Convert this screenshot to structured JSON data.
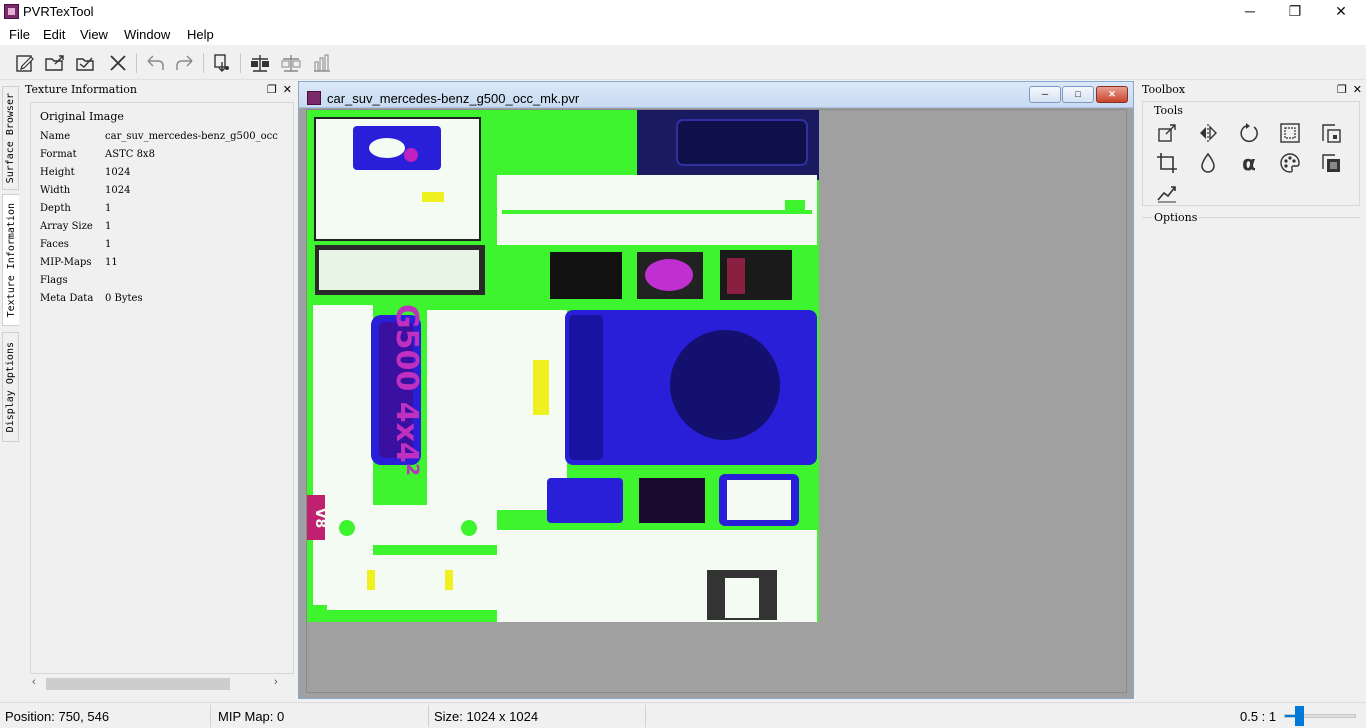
{
  "app": {
    "title": "PVRTexTool"
  },
  "window_controls": {
    "minimize": "─",
    "restore": "❐",
    "close": "✕"
  },
  "menu": [
    "File",
    "Edit",
    "View",
    "Window",
    "Help"
  ],
  "toolbar": {
    "items": [
      "new-icon",
      "open-icon",
      "open-folder-icon",
      "close-icon",
      "undo-icon",
      "redo-icon",
      "encode-icon",
      "compare-icon",
      "compare-alt-icon",
      "histogram-icon"
    ]
  },
  "left_tabs": [
    "Surface Browser",
    "Texture Information",
    "Display Options"
  ],
  "texture_info": {
    "panel_title": "Texture Information",
    "group_title": "Original Image",
    "rows": [
      {
        "key": "Name",
        "value": "car_suv_mercedes-benz_g500_occ"
      },
      {
        "key": "Format",
        "value": "ASTC 8x8"
      },
      {
        "key": "Height",
        "value": "1024"
      },
      {
        "key": "Width",
        "value": "1024"
      },
      {
        "key": "Depth",
        "value": "1"
      },
      {
        "key": "Array Size",
        "value": "1"
      },
      {
        "key": "Faces",
        "value": "1"
      },
      {
        "key": "MIP-Maps",
        "value": "11"
      },
      {
        "key": "Flags",
        "value": ""
      },
      {
        "key": "Meta Data",
        "value": "0 Bytes"
      }
    ]
  },
  "document": {
    "title": "car_suv_mercedes-benz_g500_occ_mk.pvr",
    "buttons": {
      "minimize": "─",
      "restore": "□",
      "close": "✕"
    },
    "texture_text": {
      "badge_v8": "V8",
      "badge_model": "G500 4x4²"
    }
  },
  "toolbox": {
    "title": "Toolbox",
    "tools_label": "Tools",
    "tools": [
      "resize-icon",
      "flip-icon",
      "rotate-icon",
      "border-icon",
      "channel-copy-icon",
      "crop-icon",
      "color-drop-icon",
      "alpha-icon",
      "palette-icon",
      "layer-icon",
      "normal-map-icon"
    ],
    "options_label": "Options"
  },
  "status": {
    "position": "Position: 750, 546",
    "mip": "MIP Map: 0",
    "size": "Size: 1024 x 1024",
    "zoom": "0.5 : 1",
    "zoom_level": 0.2
  },
  "colors": {
    "accent": "#0078d7",
    "texture_green": "#3ef42e",
    "texture_blue": "#2a1fd8"
  }
}
